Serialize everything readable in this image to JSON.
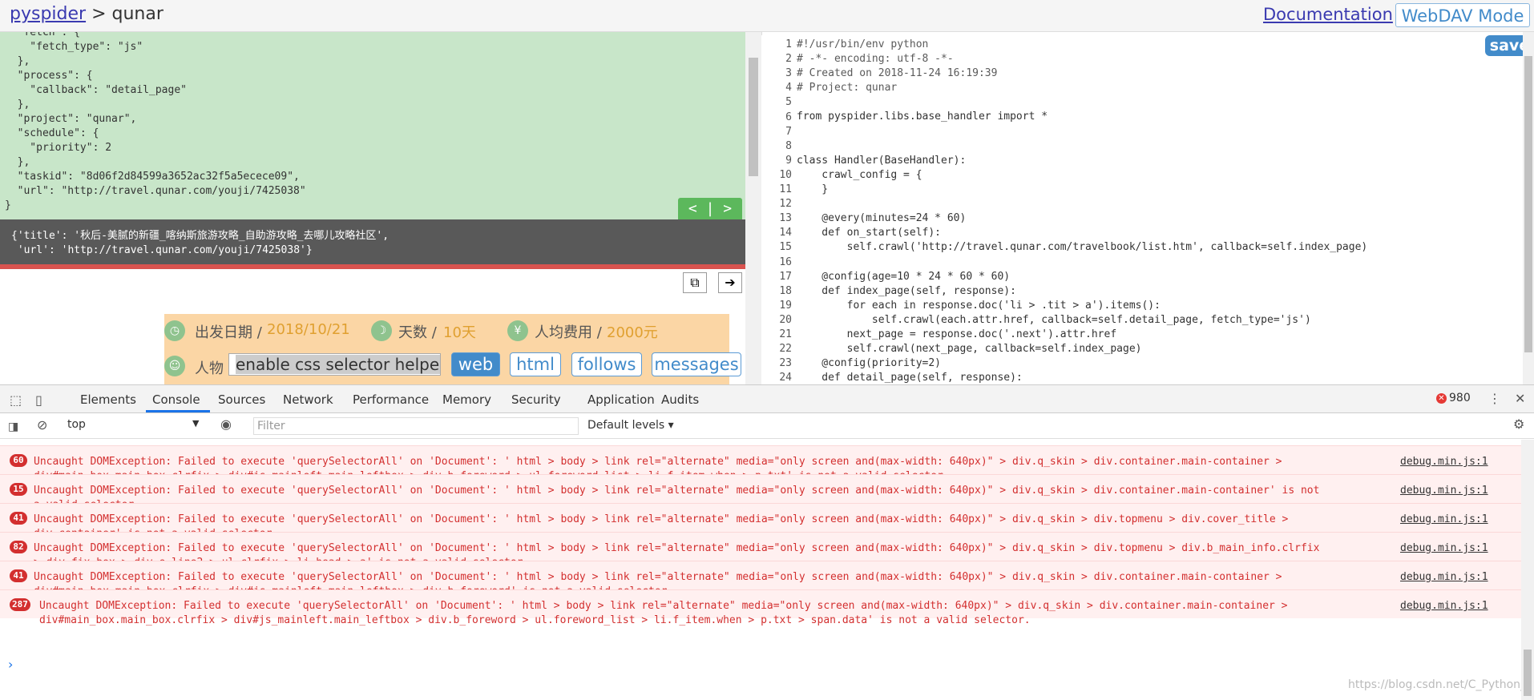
{
  "header": {
    "brand_link": "pyspider",
    "brand_sep": " > ",
    "project": "qunar",
    "documentation": "Documentation",
    "webdav": "WebDAV Mode"
  },
  "task_json_lines": [
    "  \"fetch\": {",
    "    \"fetch_type\": \"js\"",
    "  },",
    "  \"process\": {",
    "    \"callback\": \"detail_page\"",
    "  },",
    "  \"project\": \"qunar\",",
    "  \"schedule\": {",
    "    \"priority\": 2",
    "  },",
    "  \"taskid\": \"8d06f2d84599a3652ac32f5a5ecece09\",",
    "  \"url\": \"http://travel.qunar.com/youji/7425038\"",
    "}"
  ],
  "nav_buttons": "<  |  >",
  "result_lines": [
    "{'title': '秋后-美腻的新疆_喀纳斯旅游攻略_自助游攻略_去哪儿攻略社区',",
    " 'url': 'http://travel.qunar.com/youji/7425038'}"
  ],
  "preview": {
    "date_label": "出发日期 /",
    "date_value": "2018/10/21",
    "days_label": "天数 /",
    "days_value": "10天",
    "cost_label": "人均费用 /",
    "cost_value": "2000元",
    "people_label": "人物",
    "helper_placeholder": "enable css selector helper",
    "modes": [
      "web",
      "html",
      "follows",
      "messages"
    ]
  },
  "editor": {
    "save": "save",
    "line_numbers": [
      "1",
      "2",
      "3",
      "4",
      "5",
      "6",
      "7",
      "8",
      "9",
      "10",
      "11",
      "12",
      "13",
      "14",
      "15",
      "16",
      "17",
      "18",
      "19",
      "20",
      "21",
      "22",
      "23",
      "24"
    ],
    "code_lines": [
      "#!/usr/bin/env python",
      "# -*- encoding: utf-8 -*-",
      "# Created on 2018-11-24 16:19:39",
      "# Project: qunar",
      "",
      "from pyspider.libs.base_handler import *",
      "",
      "",
      "class Handler(BaseHandler):",
      "    crawl_config = {",
      "    }",
      "",
      "    @every(minutes=24 * 60)",
      "    def on_start(self):",
      "        self.crawl('http://travel.qunar.com/travelbook/list.htm', callback=self.index_page)",
      "",
      "    @config(age=10 * 24 * 60 * 60)",
      "    def index_page(self, response):",
      "        for each in response.doc('li > .tit > a').items():",
      "            self.crawl(each.attr.href, callback=self.detail_page, fetch_type='js')",
      "        next_page = response.doc('.next').attr.href",
      "        self.crawl(next_page, callback=self.index_page)",
      "    @config(priority=2)",
      "    def detail_page(self, response):"
    ]
  },
  "devtools": {
    "tabs": [
      "Elements",
      "Console",
      "Sources",
      "Network",
      "Performance",
      "Memory",
      "Security",
      "Application",
      "Audits"
    ],
    "active_tab": "Console",
    "error_count": "980",
    "context": "top",
    "filter_placeholder": "Filter",
    "levels": "Default levels ▾",
    "messages": [
      {
        "count": "60",
        "text": "Uncaught DOMException: Failed to execute 'querySelectorAll' on 'Document': ' html > body > link rel=\"alternate\" media=\"only screen and(max-width: 640px)\" > div.q_skin > div.container.main-container >\ndiv#main_box.main_box.clrfix > div#js_mainleft.main_leftbox > div.b_foreword > ul.foreword_list > li.f_item.when > p.txt' is not a valid selector.",
        "source": "debug.min.js:1"
      },
      {
        "count": "15",
        "text": "Uncaught DOMException: Failed to execute 'querySelectorAll' on 'Document': ' html > body > link rel=\"alternate\" media=\"only screen and(max-width: 640px)\" > div.q_skin > div.container.main-container' is not\na valid selector.",
        "source": "debug.min.js:1"
      },
      {
        "count": "41",
        "text": "Uncaught DOMException: Failed to execute 'querySelectorAll' on 'Document': ' html > body > link rel=\"alternate\" media=\"only screen and(max-width: 640px)\" > div.q_skin > div.topmenu > div.cover_title >\ndiv.container' is not a valid selector.",
        "source": "debug.min.js:1"
      },
      {
        "count": "82",
        "text": "Uncaught DOMException: Failed to execute 'querySelectorAll' on 'Document': ' html > body > link rel=\"alternate\" media=\"only screen and(max-width: 640px)\" > div.q_skin > div.topmenu > div.b_main_info.clrfix\n> div.fix_box > div.e_line2 > ul.clrfix > li.head > a' is not a valid selector.",
        "source": "debug.min.js:1"
      },
      {
        "count": "41",
        "text": "Uncaught DOMException: Failed to execute 'querySelectorAll' on 'Document': ' html > body > link rel=\"alternate\" media=\"only screen and(max-width: 640px)\" > div.q_skin > div.container.main-container >\ndiv#main_box.main_box.clrfix > div#js_mainleft.main_leftbox > div.b_foreword' is not a valid selector.",
        "source": "debug.min.js:1"
      },
      {
        "count": "287",
        "text": "Uncaught DOMException: Failed to execute 'querySelectorAll' on 'Document': ' html > body > link rel=\"alternate\" media=\"only screen and(max-width: 640px)\" > div.q_skin > div.container.main-container >\ndiv#main_box.main_box.clrfix > div#js_mainleft.main_leftbox > div.b_foreword > ul.foreword_list > li.f_item.when > p.txt > span.data' is not a valid selector.",
        "source": "debug.min.js:1"
      }
    ],
    "prompt": "›",
    "watermark": "https://blog.csdn.net/C_Python_"
  }
}
